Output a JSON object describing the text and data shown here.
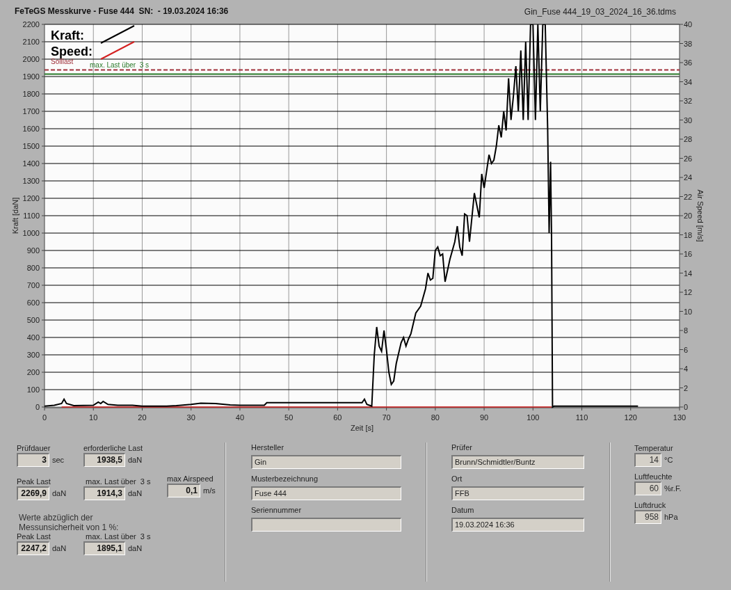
{
  "header": {
    "title": "FeTeGS Messkurve - Fuse 444  SN:  - 19.03.2024 16:36",
    "file": "Gin_Fuse 444_19_03_2024_16_36.tdms"
  },
  "chart": {
    "chart_data": {
      "type": "line",
      "xlabel": "Zeit [s]",
      "ylabel": "Kraft [daN]",
      "y2label": "Air Speed [m/s]",
      "x": [
        0,
        2,
        3.5,
        4,
        4.5,
        6,
        10,
        11,
        11.5,
        12,
        13,
        15,
        18,
        20,
        25,
        27,
        30,
        32,
        35,
        38,
        40,
        45,
        45.5,
        50,
        55,
        60,
        65,
        65.5,
        66,
        67,
        67.5,
        68,
        68.5,
        69,
        69.5,
        70,
        70.5,
        71,
        71.5,
        72,
        73,
        73.5,
        74,
        74.5,
        75,
        76,
        77,
        78,
        78.5,
        79,
        79.5,
        80,
        80.5,
        81,
        81.5,
        82,
        83,
        84,
        84.5,
        85,
        85.5,
        86,
        86.5,
        87,
        88,
        89,
        89.5,
        90,
        91,
        91.5,
        92,
        92.5,
        93,
        93.5,
        94,
        94.5,
        95,
        95.5,
        96,
        96.5,
        97,
        97.5,
        98,
        98.5,
        99,
        99.5,
        100,
        100.5,
        101,
        101.5,
        102,
        102.5,
        103,
        103.3,
        103.6,
        103.8,
        104,
        104.3,
        110,
        121.5
      ],
      "series": [
        {
          "name": "Kraft:",
          "color": "#000000",
          "values": [
            5,
            10,
            20,
            45,
            20,
            8,
            10,
            28,
            20,
            32,
            15,
            10,
            10,
            5,
            5,
            8,
            15,
            22,
            20,
            12,
            10,
            10,
            25,
            25,
            25,
            25,
            25,
            45,
            15,
            5,
            300,
            460,
            350,
            320,
            440,
            330,
            200,
            130,
            150,
            250,
            370,
            400,
            350,
            390,
            420,
            540,
            580,
            680,
            770,
            730,
            740,
            900,
            920,
            870,
            880,
            720,
            850,
            950,
            1040,
            920,
            870,
            1110,
            1100,
            950,
            1230,
            1090,
            1340,
            1260,
            1450,
            1400,
            1420,
            1500,
            1620,
            1550,
            1700,
            1590,
            1890,
            1650,
            1790,
            1960,
            1700,
            2050,
            1650,
            2100,
            1650,
            2200,
            2200,
            1650,
            2200,
            1700,
            2200,
            2200,
            1600,
            1000,
            1410,
            980,
            0,
            5,
            5,
            5
          ]
        },
        {
          "name": "Speed:",
          "color": "#d42020",
          "values": [
            null,
            null,
            0,
            0,
            0,
            null,
            null,
            0,
            0,
            0,
            null,
            null,
            null,
            null,
            null,
            null,
            null,
            0,
            0,
            null,
            null,
            null,
            0,
            0,
            0,
            0,
            0,
            0,
            null,
            null,
            0,
            0,
            0,
            0,
            0,
            0,
            0,
            0,
            0,
            0,
            0,
            0,
            0,
            0,
            0,
            0,
            0,
            0,
            0,
            0,
            0,
            0,
            0,
            0,
            0,
            0,
            0,
            0,
            0,
            0,
            0,
            0,
            0,
            0,
            0,
            0,
            0,
            0,
            0,
            0,
            0,
            0,
            0,
            0,
            0,
            0,
            0,
            0,
            0,
            0,
            0,
            0,
            0,
            0,
            0,
            0,
            0,
            0,
            0,
            0,
            0,
            0,
            0,
            0,
            0,
            0,
            null,
            null,
            null,
            null
          ]
        }
      ],
      "grid": true,
      "legend": "upper left",
      "xlim": [
        0,
        130
      ],
      "ylim": [
        0,
        2200
      ],
      "y2lim": [
        0,
        40
      ],
      "xticks": [
        0,
        10,
        20,
        30,
        40,
        50,
        60,
        70,
        80,
        90,
        100,
        110,
        120,
        130
      ],
      "yticks": [
        0,
        100,
        200,
        300,
        400,
        500,
        600,
        700,
        800,
        900,
        1000,
        1100,
        1200,
        1300,
        1400,
        1500,
        1600,
        1700,
        1800,
        1900,
        2000,
        2100,
        2200
      ],
      "y2ticks": [
        0,
        2,
        4,
        6,
        8,
        10,
        12,
        14,
        16,
        18,
        20,
        22,
        24,
        26,
        28,
        30,
        32,
        34,
        36,
        38,
        40
      ],
      "ref_lines": [
        {
          "axis": "y",
          "value": 1938.5,
          "label": "Solllast",
          "color": "#a0303a"
        },
        {
          "axis": "y",
          "value": 1914.3,
          "label": "max. Last über  3 s",
          "color": "#2a7a2a"
        }
      ]
    }
  },
  "results": [
    {
      "label": "Prüfdauer",
      "value": "3",
      "unit": "sec"
    },
    {
      "label": "erforderliche Last",
      "value": "1938,5",
      "unit": "daN"
    },
    {
      "label": "Peak Last",
      "value": "2269,9",
      "unit": "daN"
    },
    {
      "label": "max. Last über  3 s",
      "value": "1914,3",
      "unit": "daN"
    },
    {
      "label": "max Airspeed",
      "value": "0,1",
      "unit": "m/s"
    }
  ],
  "uncertainty_note": "Werte abzüglich der\nMessunsicherheit von 1  %:",
  "reduced": [
    {
      "label": "Peak Last",
      "value": "2247,2",
      "unit": "daN"
    },
    {
      "label": "max. Last über  3 s",
      "value": "1895,1",
      "unit": "daN"
    }
  ],
  "info_left": [
    {
      "label": "Hersteller",
      "value": "Gin"
    },
    {
      "label": "Musterbezeichnung",
      "value": "Fuse 444"
    },
    {
      "label": "Seriennummer"
    }
  ],
  "info_right": [
    {
      "label": "Prüfer",
      "value": "Brunn/Schmidtler/Buntz"
    },
    {
      "label": "Ort",
      "value": "FFB"
    },
    {
      "label": "Datum",
      "value": "19.03.2024 16:36"
    }
  ],
  "conditions": [
    {
      "label": "Temperatur",
      "value": "14",
      "unit": "°C"
    },
    {
      "label": "Luftfeuchte",
      "value": "60",
      "unit": "%r.F."
    },
    {
      "label": "Luftdruck",
      "value": "958",
      "unit": "hPa"
    }
  ]
}
